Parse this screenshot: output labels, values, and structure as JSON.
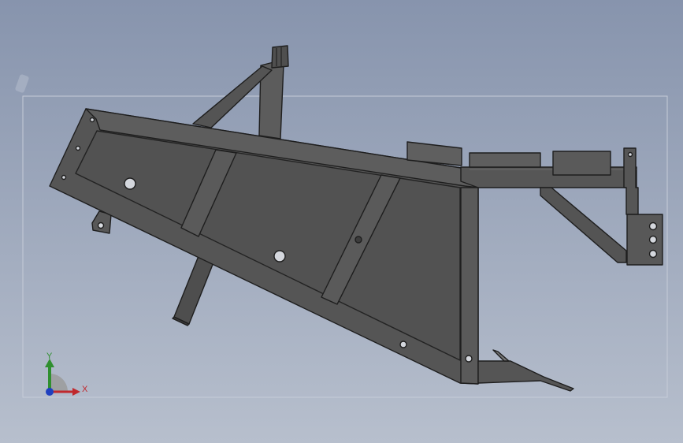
{
  "viewport": {
    "background_top": "#8794ad",
    "background_bottom": "#b7bfcd",
    "part_color": "#555555",
    "edge_color": "#1e1e1e"
  },
  "triad": {
    "x_label": "X",
    "y_label": "Y",
    "x_color": "#c0282d",
    "y_color": "#2f8f2f",
    "z_color": "#1f3fbf"
  }
}
